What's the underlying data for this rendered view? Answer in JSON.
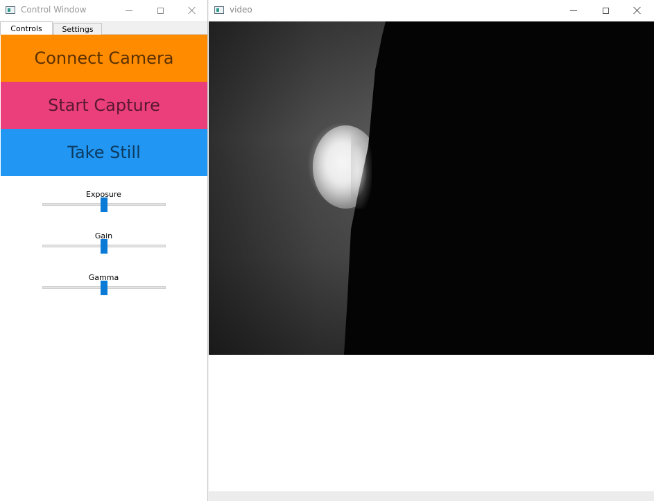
{
  "control_window": {
    "title": "Control Window",
    "icon": "app-icon",
    "title_buttons": [
      "minimize-icon",
      "maximize-icon",
      "close-icon"
    ],
    "tabs": [
      {
        "label": "Controls",
        "active": true
      },
      {
        "label": "Settings",
        "active": false
      }
    ],
    "buttons": {
      "connect_camera": {
        "label": "Connect Camera",
        "bg": "#ff8b00",
        "fg": "#5a3100"
      },
      "start_capture": {
        "label": "Start Capture",
        "bg": "#eb3f7b",
        "fg": "#5a1830"
      },
      "take_still": {
        "label": "Take Still",
        "bg": "#2196f3",
        "fg": "#0d3a5e"
      }
    },
    "sliders": {
      "exposure": {
        "label": "Exposure",
        "value": 0.5
      },
      "gain": {
        "label": "Gain",
        "value": 0.5
      },
      "gamma": {
        "label": "Gamma",
        "value": 0.5
      }
    },
    "accent": "#0a7ad6"
  },
  "video_window": {
    "title": "video",
    "icon": "app-icon",
    "title_buttons": [
      "minimize-icon",
      "maximize-icon",
      "close-icon"
    ]
  }
}
